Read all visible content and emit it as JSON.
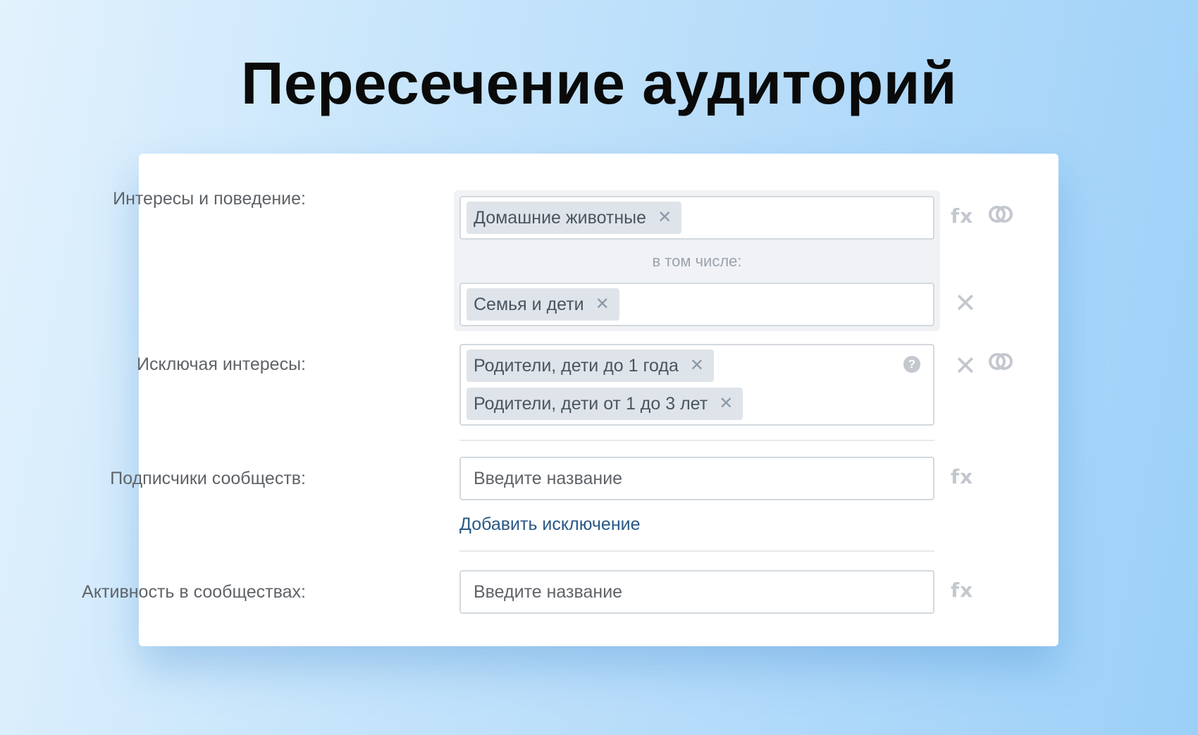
{
  "title": "Пересечение аудиторий",
  "interests": {
    "label": "Интересы и поведение:",
    "tag": "Домашние животные",
    "including_label": "в том числе:",
    "including_tag": "Семья и дети",
    "formula_icon_text": "fx"
  },
  "excluding": {
    "label": "Исключая интересы:",
    "tags": [
      "Родители, дети до 1 года",
      "Родители, дети от 1 до 3 лет"
    ],
    "help_icon_text": "?"
  },
  "subscribers": {
    "label": "Подписчики сообществ:",
    "placeholder": "Введите название",
    "formula_icon_text": "fx",
    "add_exclusion_link": "Добавить исключение"
  },
  "activity": {
    "label": "Активность в сообществах:",
    "placeholder": "Введите название",
    "formula_icon_text": "fx"
  },
  "icons": {
    "chip_remove": "close-icon",
    "row_remove": "close-icon",
    "intersection": "intersection-icon",
    "formula": "fx-icon",
    "help": "help-icon"
  },
  "colors": {
    "link": "#2a5885",
    "chip_bg": "#dfe4ea",
    "icon_gray": "#c3c8ce",
    "group_bg": "#f0f2f5"
  }
}
